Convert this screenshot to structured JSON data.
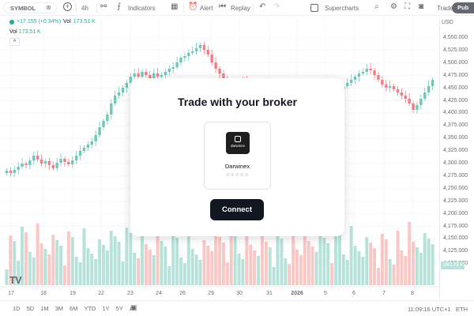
{
  "toolbar": {
    "symbol": "SYMBOL",
    "interval": "4h",
    "indicators": "Indicators",
    "alert": "Alert",
    "replay": "Replay",
    "supercharts": "Supercharts",
    "trade": "Trade",
    "publish": "Pub"
  },
  "legend": {
    "change": "+17.155 (+0.34%)",
    "vol_label_inline": "Vol",
    "vol_value_inline": "173.51 K",
    "vol_label": "Vol",
    "vol_value": "173.51 K"
  },
  "currency": "USD",
  "price_axis": [
    "4,550.000",
    "4,525.000",
    "4,500.000",
    "4,475.000",
    "4,450.000",
    "4,425.000",
    "4,400.000",
    "4,375.000",
    "4,350.000",
    "4,325.000",
    "4,300.000",
    "4,275.000",
    "4,250.000",
    "4,225.000",
    "4,200.000",
    "4,175.000",
    "4,150.000",
    "4,125.000",
    "4,100.000"
  ],
  "volume_badge": "260.79 K",
  "time_axis": [
    "17",
    "18",
    "19",
    "22",
    "23",
    "24",
    "26",
    "29",
    "30",
    "31",
    "2026",
    "5",
    "6",
    "7",
    "8"
  ],
  "bottom": {
    "ranges": [
      "1D",
      "5D",
      "1M",
      "3M",
      "6M",
      "YTD",
      "1Y",
      "5Y",
      "All"
    ],
    "time": "11:09:16 UTC+1",
    "symbol_short": "ETH"
  },
  "modal": {
    "title": "Trade with your broker",
    "broker_name": "Darwinex",
    "broker_logo_text": "darwinex",
    "stars": "☆☆☆☆☆",
    "connect": "Connect"
  },
  "colors": {
    "up": "#22ab94",
    "down": "#f23645",
    "vol_up": "#8fd3c7",
    "vol_down": "#f7a9a7"
  }
}
